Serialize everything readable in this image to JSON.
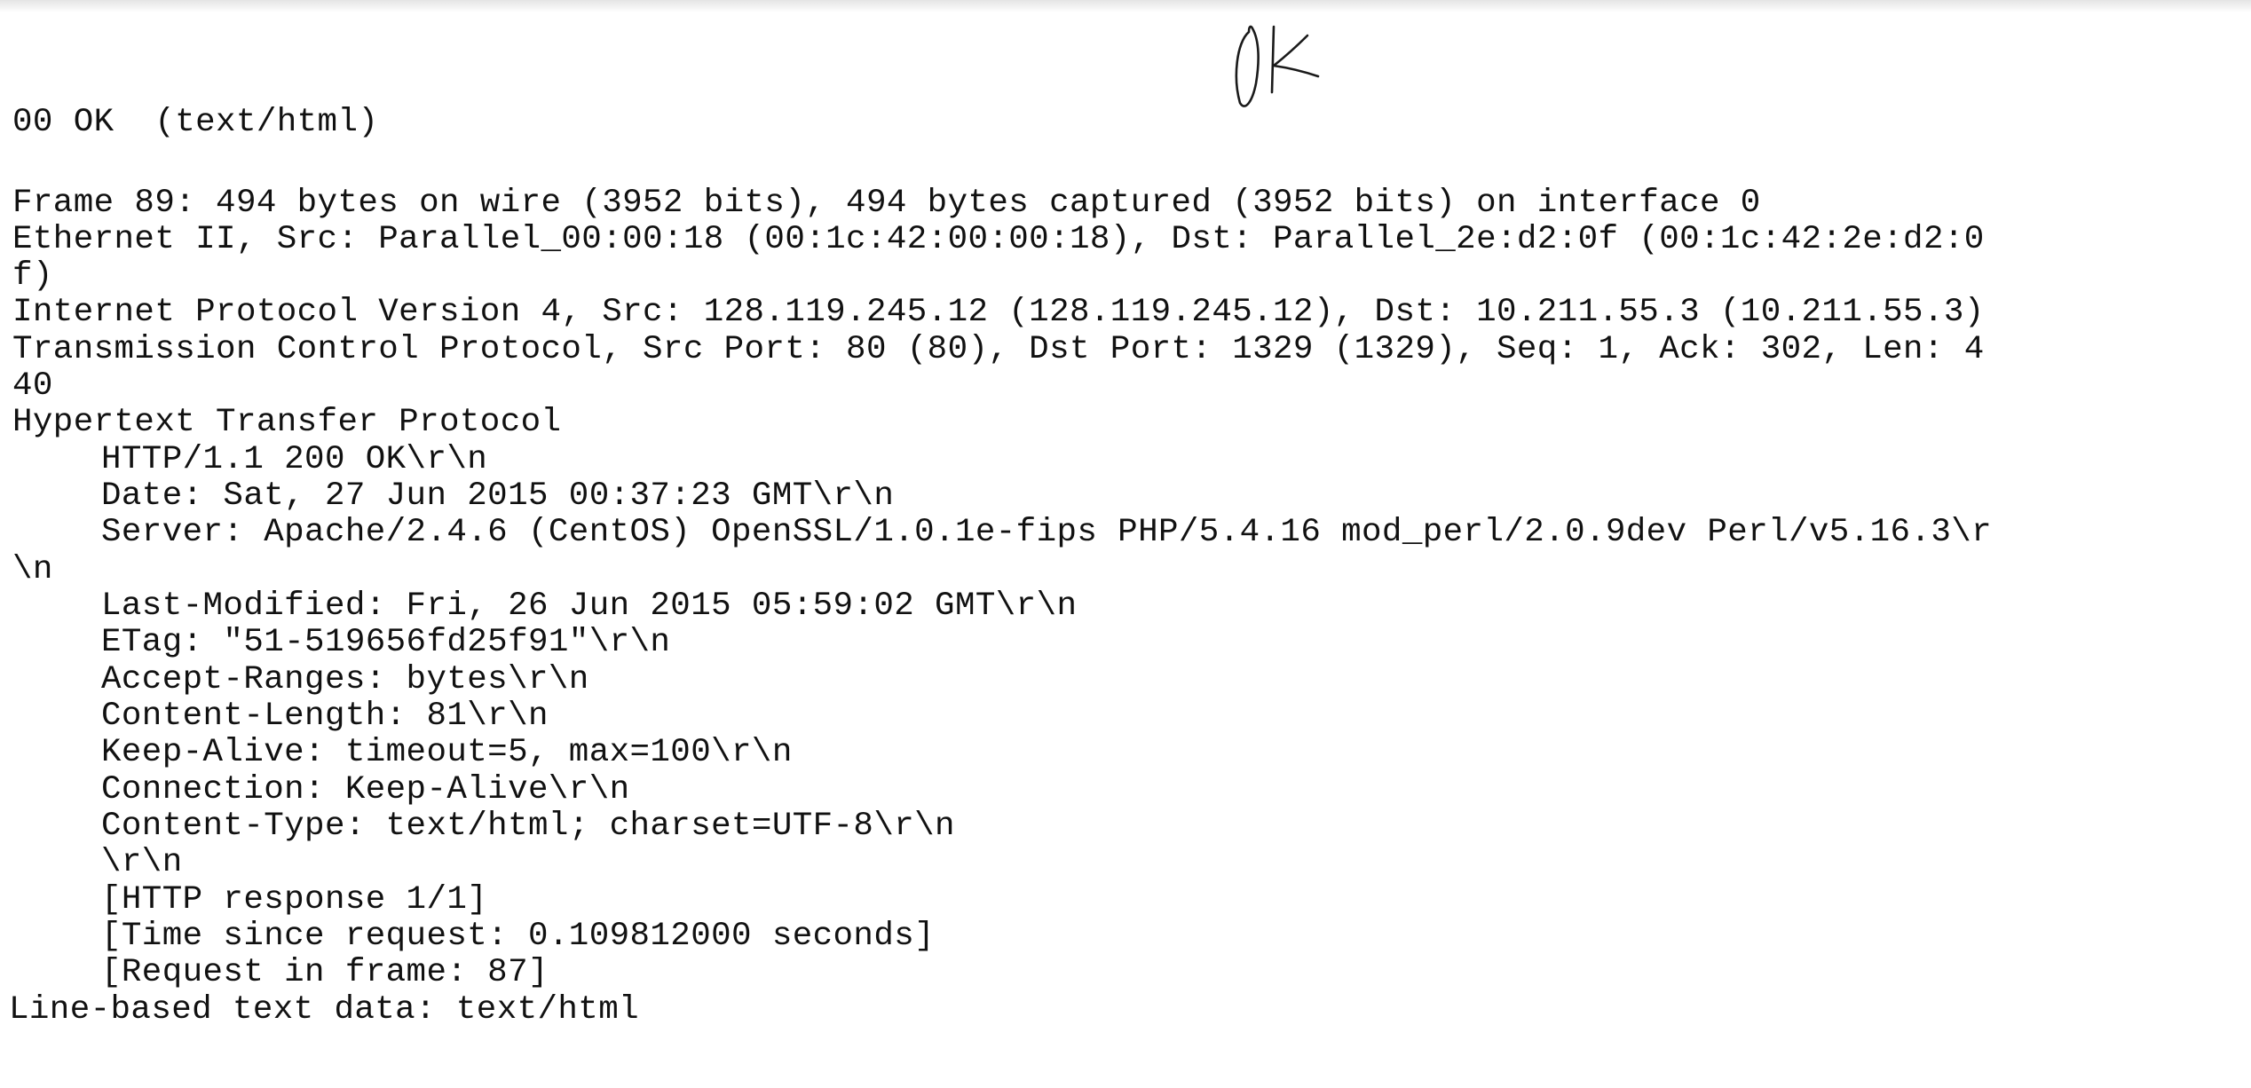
{
  "annotation": {
    "handwritten_note": "ok"
  },
  "packet": {
    "clipped_header": "00 OK  (text/html)",
    "frame": "Frame 89: 494 bytes on wire (3952 bits), 494 bytes captured (3952 bits) on interface 0",
    "ethernet_line1": "Ethernet II, Src: Parallel_00:00:18 (00:1c:42:00:00:18), Dst: Parallel_2e:d2:0f (00:1c:42:2e:d2:0",
    "ethernet_line2": "f)",
    "ip": "Internet Protocol Version 4, Src: 128.119.245.12 (128.119.245.12), Dst: 10.211.55.3 (10.211.55.3)",
    "tcp_line1": "Transmission Control Protocol, Src Port: 80 (80), Dst Port: 1329 (1329), Seq: 1, Ack: 302, Len: 4",
    "tcp_line2": "40",
    "http_title": "Hypertext Transfer Protocol",
    "http": {
      "status": "HTTP/1.1 200 OK\\r\\n",
      "date": "Date: Sat, 27 Jun 2015 00:37:23 GMT\\r\\n",
      "server_line1": "Server: Apache/2.4.6 (CentOS) OpenSSL/1.0.1e-fips PHP/5.4.16 mod_perl/2.0.9dev Perl/v5.16.3\\r",
      "server_line2": "\\n",
      "last_modified": "Last-Modified: Fri, 26 Jun 2015 05:59:02 GMT\\r\\n",
      "etag": "ETag: \"51-519656fd25f91\"\\r\\n",
      "accept_ranges": "Accept-Ranges: bytes\\r\\n",
      "content_length": "Content-Length: 81\\r\\n",
      "keep_alive": "Keep-Alive: timeout=5, max=100\\r\\n",
      "connection": "Connection: Keep-Alive\\r\\n",
      "content_type": "Content-Type: text/html; charset=UTF-8\\r\\n",
      "crlf": "\\r\\n",
      "response_num": "[HTTP response 1/1]",
      "time_since": "[Time since request: 0.109812000 seconds]",
      "request_in": "[Request in frame: 87]"
    },
    "line_based": "Line-based text data: text/html"
  }
}
